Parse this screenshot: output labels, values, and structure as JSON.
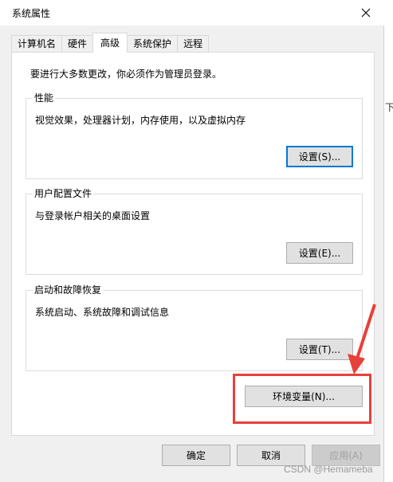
{
  "window": {
    "title": "系统属性"
  },
  "tabs": [
    {
      "label": "计算机名"
    },
    {
      "label": "硬件"
    },
    {
      "label": "高级"
    },
    {
      "label": "系统保护"
    },
    {
      "label": "远程"
    }
  ],
  "panel": {
    "notice": "要进行大多数更改，你必须作为管理员登录。",
    "performance": {
      "label": "性能",
      "desc": "视觉效果，处理器计划，内存使用，以及虚拟内存",
      "button": "设置(S)..."
    },
    "user_profiles": {
      "label": "用户配置文件",
      "desc": "与登录帐户相关的桌面设置",
      "button": "设置(E)..."
    },
    "startup_recovery": {
      "label": "启动和故障恢复",
      "desc": "系统启动、系统故障和调试信息",
      "button": "设置(T)..."
    },
    "env_button": "环境变量(N)..."
  },
  "footer": {
    "ok": "确定",
    "cancel": "取消",
    "apply": "应用(A)"
  },
  "side_glyph": "下",
  "watermark": "CSDN @Hemameba",
  "colors": {
    "annotation_red": "#e8403a",
    "focus_blue": "#0078d7"
  }
}
